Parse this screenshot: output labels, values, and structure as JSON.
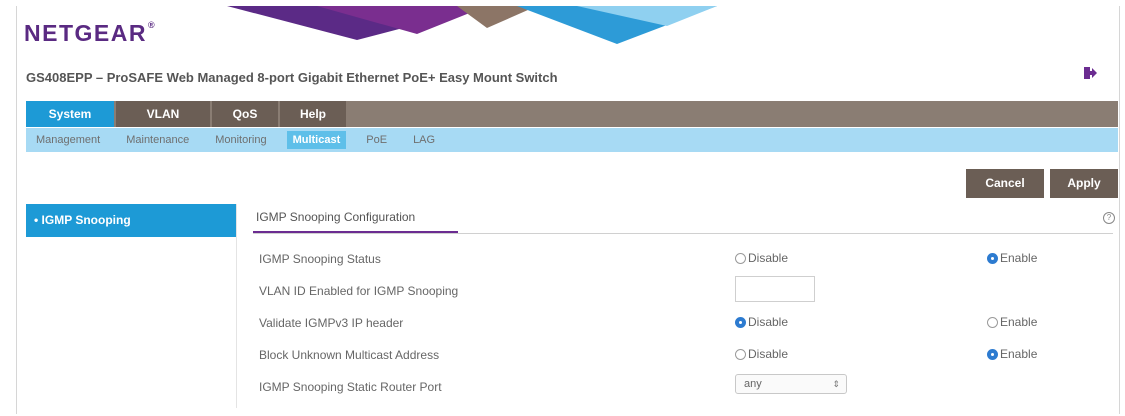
{
  "brand": {
    "logo_text": "NETGEAR",
    "logo_mark": "®"
  },
  "product_title": "GS408EPP – ProSAFE Web Managed 8-port Gigabit Ethernet PoE+ Easy Mount Switch",
  "main_nav": [
    {
      "label": "System",
      "active": true
    },
    {
      "label": "VLAN",
      "active": false
    },
    {
      "label": "QoS",
      "active": false
    },
    {
      "label": "Help",
      "active": false
    }
  ],
  "sub_nav": [
    {
      "label": "Management",
      "active": false
    },
    {
      "label": "Maintenance",
      "active": false
    },
    {
      "label": "Monitoring",
      "active": false
    },
    {
      "label": "Multicast",
      "active": true
    },
    {
      "label": "PoE",
      "active": false
    },
    {
      "label": "LAG",
      "active": false
    }
  ],
  "actions": {
    "cancel_label": "Cancel",
    "apply_label": "Apply"
  },
  "sidebar": {
    "items": [
      {
        "label": "IGMP Snooping",
        "bullet": "•",
        "active": true
      }
    ]
  },
  "section": {
    "title": "IGMP Snooping Configuration",
    "help_glyph": "?"
  },
  "settings": {
    "igmp_status": {
      "label": "IGMP Snooping Status",
      "option_a": "Disable",
      "option_b": "Enable",
      "selected": "Enable"
    },
    "vlan_id": {
      "label": "VLAN ID Enabled for IGMP Snooping",
      "value": ""
    },
    "validate_header": {
      "label": "Validate IGMPv3 IP header",
      "option_a": "Disable",
      "option_b": "Enable",
      "selected": "Disable"
    },
    "block_unknown": {
      "label": "Block Unknown Multicast Address",
      "option_a": "Disable",
      "option_b": "Enable",
      "selected": "Enable"
    },
    "static_router_port": {
      "label": "IGMP Snooping Static Router Port",
      "value": "any"
    }
  },
  "colors": {
    "brand_purple": "#5a2a82",
    "nav_active_blue": "#1d9ad6",
    "nav_bar_brown": "#8a7d73",
    "subnav_light_blue": "#a7daf4",
    "button_brown": "#6b5e55"
  },
  "icons": {
    "logout": "logout-icon",
    "help": "help-icon",
    "select_arrow": "chevron-updown-icon"
  }
}
